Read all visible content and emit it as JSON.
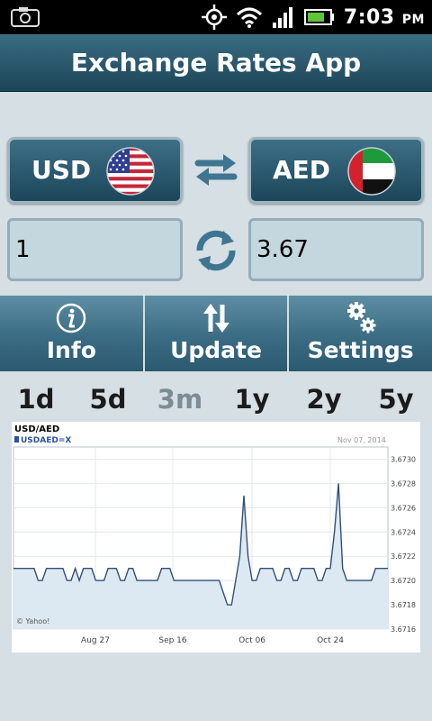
{
  "status_bar": {
    "time": "7:03",
    "ampm": "PM",
    "icons": [
      "screenshot-icon",
      "gps-icon",
      "wifi-icon",
      "signal-icon",
      "battery-icon"
    ]
  },
  "app": {
    "title": "Exchange Rates App"
  },
  "converter": {
    "from_currency": "USD",
    "to_currency": "AED",
    "from_amount": "1",
    "to_amount": "3.67"
  },
  "toolbar": {
    "info": "Info",
    "update": "Update",
    "settings": "Settings"
  },
  "ranges": [
    {
      "label": "1d",
      "enabled": true
    },
    {
      "label": "5d",
      "enabled": true
    },
    {
      "label": "3m",
      "enabled": false
    },
    {
      "label": "1y",
      "enabled": true
    },
    {
      "label": "2y",
      "enabled": true
    },
    {
      "label": "5y",
      "enabled": true
    }
  ],
  "colors": {
    "accent": "#2c5a70",
    "background": "#d5dfe4",
    "chart_line": "#2f4f7a",
    "chart_fill": "#dce9f2"
  },
  "chart_data": {
    "type": "area",
    "title": "USD/AED",
    "series_label": "USDAED=X",
    "date": "Nov 07, 2014",
    "credit": "© Yahoo!",
    "x_tick_labels": [
      "Aug 27",
      "Sep 16",
      "Oct 06",
      "Oct 24"
    ],
    "y_ticks": [
      "3.6730",
      "3.6728",
      "3.6726",
      "3.6724",
      "3.6722",
      "3.6720",
      "3.6718",
      "3.6716"
    ],
    "ylim": [
      3.6716,
      3.6731
    ],
    "grid": true,
    "series": [
      {
        "name": "USDAED=X",
        "values": [
          3.6721,
          3.6721,
          3.6721,
          3.6721,
          3.6721,
          3.6721,
          3.672,
          3.672,
          3.6721,
          3.6721,
          3.6721,
          3.6721,
          3.6721,
          3.672,
          3.672,
          3.6721,
          3.672,
          3.6721,
          3.6721,
          3.6721,
          3.672,
          3.672,
          3.672,
          3.6721,
          3.6721,
          3.6721,
          3.672,
          3.672,
          3.6721,
          3.6721,
          3.672,
          3.672,
          3.672,
          3.672,
          3.672,
          3.672,
          3.6721,
          3.6721,
          3.6721,
          3.672,
          3.672,
          3.672,
          3.672,
          3.672,
          3.672,
          3.672,
          3.672,
          3.672,
          3.672,
          3.672,
          3.672,
          3.6719,
          3.6718,
          3.6718,
          3.672,
          3.6722,
          3.6727,
          3.6722,
          3.672,
          3.672,
          3.6721,
          3.6721,
          3.6721,
          3.6721,
          3.672,
          3.672,
          3.6721,
          3.6721,
          3.672,
          3.672,
          3.6721,
          3.6721,
          3.6721,
          3.6721,
          3.672,
          3.672,
          3.6721,
          3.6721,
          3.6724,
          3.6728,
          3.6721,
          3.672,
          3.672,
          3.672,
          3.672,
          3.672,
          3.672,
          3.672,
          3.6721,
          3.6721,
          3.6721,
          3.6721
        ]
      }
    ]
  }
}
